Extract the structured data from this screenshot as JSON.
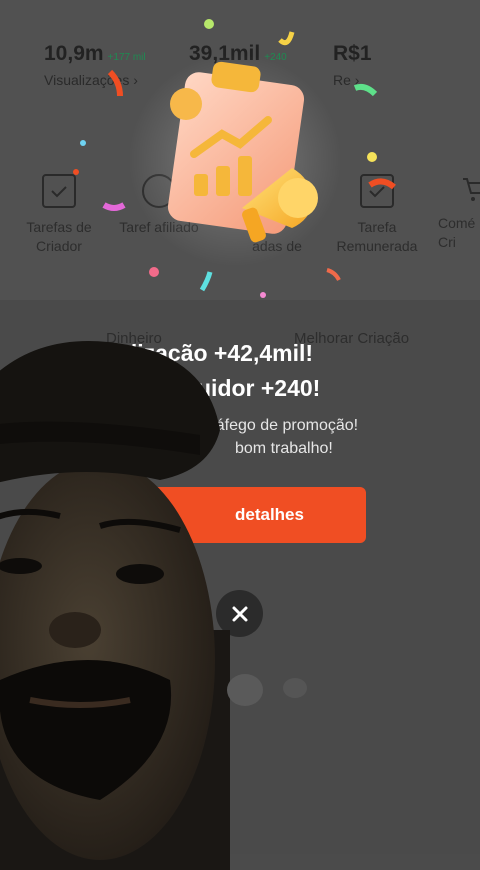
{
  "stats": [
    {
      "value": "10,9m",
      "delta": "+177 mil",
      "label": "Visualizações"
    },
    {
      "value": "39,1mil",
      "delta": "+240",
      "label": "Se"
    },
    {
      "value": "R$1",
      "delta": "",
      "label": "Re"
    }
  ],
  "actions": [
    {
      "label": "Tarefas de Criador",
      "icon": "calendar-check-icon"
    },
    {
      "label": "Taref afiliado",
      "icon": "person-icon"
    },
    {
      "label": "adas de",
      "icon": "gift-icon"
    },
    {
      "label": "Tarefa Remunerada",
      "icon": "calendar-check-icon"
    },
    {
      "label": "Comé Cri",
      "icon": "cart-icon"
    }
  ],
  "sections": {
    "left": "Dinheiro",
    "right": "Melhorar Criação"
  },
  "modal": {
    "headline_1": "ualização +42,4mil!",
    "headline_2": "uidor +240!",
    "sub_1": "tráfego de promoção!",
    "sub_2": "bom trabalho!",
    "cta": "detalhes"
  },
  "colors": {
    "cta": "#f04e23",
    "background": "#4a4a4a",
    "delta_green": "#1f8a52"
  }
}
